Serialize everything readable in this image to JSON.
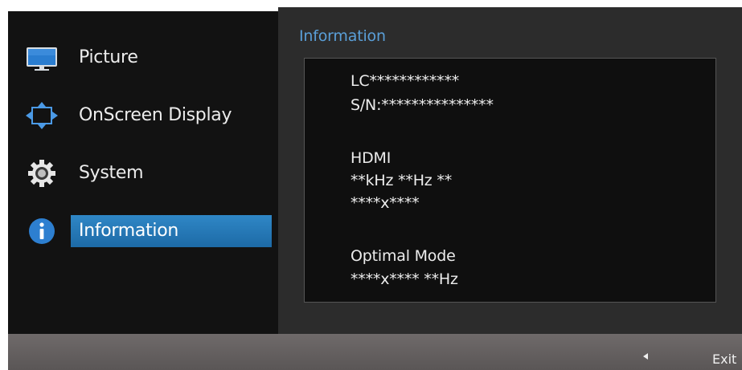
{
  "menu": {
    "items": [
      {
        "label": "Picture",
        "icon": "monitor-icon"
      },
      {
        "label": "OnScreen Display",
        "icon": "osd-arrows-icon"
      },
      {
        "label": "System",
        "icon": "gear-icon"
      },
      {
        "label": "Information",
        "icon": "info-icon",
        "selected": true
      }
    ]
  },
  "info": {
    "title": "Information",
    "model": "LC************",
    "serial": "S/N:***************",
    "input_source": "HDMI",
    "frequency": "**kHz **Hz **",
    "resolution": "****x****",
    "optimal_mode_label": "Optimal Mode",
    "optimal_mode_value": "****x**** **Hz"
  },
  "footer": {
    "exit_label": "Exit",
    "exit_icon": "left-arrow-icon"
  },
  "colors": {
    "accent_blue": "#2f87c6",
    "title_blue": "#5a9fd8",
    "info_icon_blue": "#2d7fd0"
  }
}
